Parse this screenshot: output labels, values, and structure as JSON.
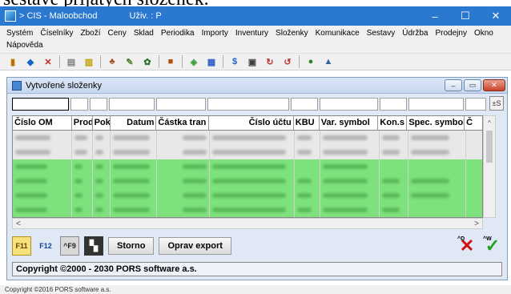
{
  "top_caption": "sestavě přijatých složenek.",
  "window": {
    "title": "> CIS - Maloobchod",
    "user_label": "Uživ. : P",
    "btn_minimize": "–",
    "btn_maximize": "☐",
    "btn_close": "✕"
  },
  "menu": [
    "Systém",
    "Číselníky",
    "Zboží",
    "Ceny",
    "Sklad",
    "Periodika",
    "Importy",
    "Inventury",
    "Složenky",
    "Komunikace",
    "Sestavy",
    "Údržba",
    "Prodejny",
    "Okno",
    "Nápověda"
  ],
  "mdi": {
    "title": "Vytvořené složenky",
    "btn_min": "–",
    "btn_restore": "▭",
    "btn_close": "✕",
    "sum_button": "±S"
  },
  "grid": {
    "columns": [
      "Číslo OM",
      "Prod",
      "Pok",
      "Datum",
      "Částka tran",
      "Číslo účtu",
      "KBU",
      "Var. symbol",
      "Kon.s",
      "Spec. symbol",
      "Č"
    ],
    "rows": [
      {
        "style": "grey"
      },
      {
        "style": "grey"
      },
      {
        "style": "green"
      },
      {
        "style": "green"
      },
      {
        "style": "green"
      },
      {
        "style": "green"
      },
      {
        "style": "green"
      }
    ]
  },
  "scroll": {
    "left": "<",
    "right": ">",
    "up": "^",
    "down": "v"
  },
  "bottom_toolbar": {
    "f11": "F11",
    "f12": "F12",
    "f9": "^F9",
    "storno": "Storno",
    "oprav_export": "Oprav export",
    "cancel_label": "^D",
    "confirm_label": "^W"
  },
  "copyright": "Copyright  ©2000 - 2030  PORS software a.s.",
  "statusbar": "Copyright ©2016 PORS software a.s.",
  "colors": {
    "titlebar": "#2b78d0",
    "row_green": "#7de27d",
    "row_grey": "#e8e8e8"
  }
}
